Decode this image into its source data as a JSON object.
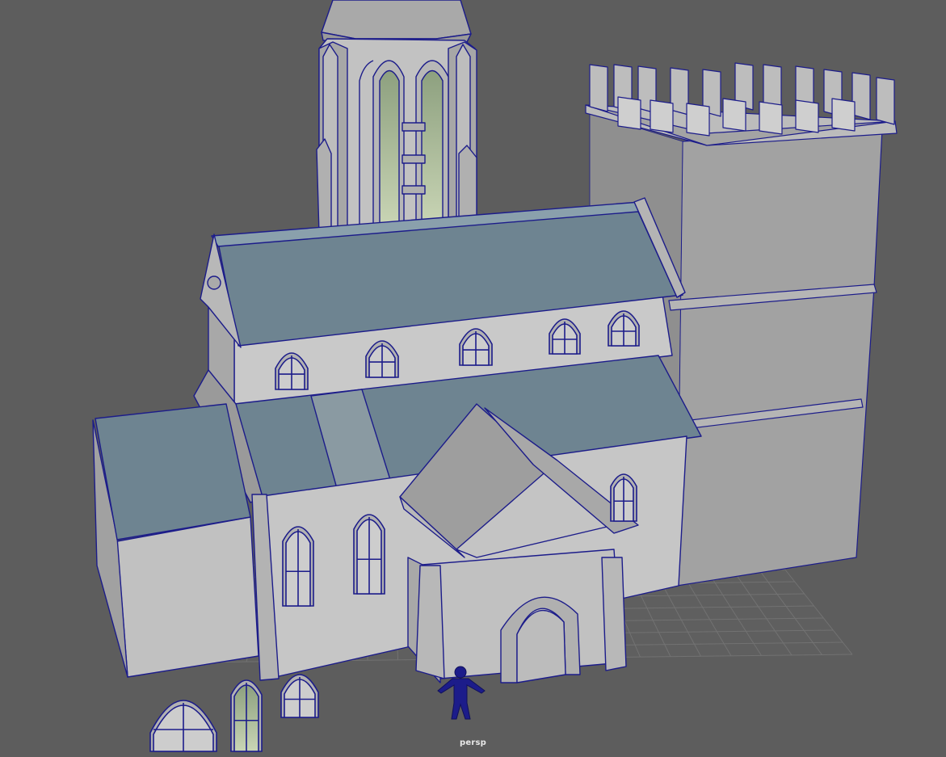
{
  "viewport": {
    "camera_label": "persp",
    "background_color": "#5d5d5d",
    "grid_color": "#707070",
    "wire_color": "#1c1c8a",
    "wall_color": "#b4b4b4",
    "roof_color": "#6e8491",
    "glass_color": "#b9c7a8"
  },
  "scene": {
    "objects": [
      "bell-tower",
      "castle-tower",
      "nave",
      "side-aisle-roof",
      "side-chapel",
      "entrance-porch",
      "human-reference-figure",
      "window-assets"
    ]
  }
}
